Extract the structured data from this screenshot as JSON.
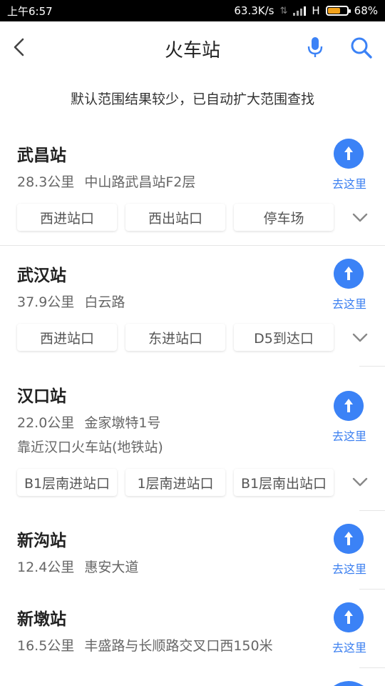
{
  "status_bar": {
    "time": "上午6:57",
    "speed": "63.3K/s",
    "network": "H",
    "battery": "68%",
    "battery_level": 0.68
  },
  "header": {
    "title": "火车站"
  },
  "notice": "默认范围结果较少，已自动扩大范围查找",
  "go_label": "去这里",
  "results": [
    {
      "name": "武昌站",
      "distance": "28.3公里",
      "address": "中山路武昌站F2层",
      "sub": "",
      "chips": [
        "西进站口",
        "西出站口",
        "停车场"
      ]
    },
    {
      "name": "武汉站",
      "distance": "37.9公里",
      "address": "白云路",
      "sub": "",
      "chips": [
        "西进站口",
        "东进站口",
        "D5到达口"
      ]
    },
    {
      "name": "汉口站",
      "distance": "22.0公里",
      "address": "金家墩特1号",
      "sub": "靠近汉口火车站(地铁站)",
      "chips": [
        "B1层南进站口",
        "1层南进站口",
        "B1层南出站口"
      ]
    },
    {
      "name": "新沟站",
      "distance": "12.4公里",
      "address": "惠安大道",
      "sub": "",
      "chips": []
    },
    {
      "name": "新墩站",
      "distance": "16.5公里",
      "address": "丰盛路与长顺路交叉口西150米",
      "sub": "",
      "chips": []
    }
  ],
  "colors": {
    "accent": "#3b82f6",
    "status_bar_bg": "#000000",
    "battery": "#f3a21a"
  }
}
